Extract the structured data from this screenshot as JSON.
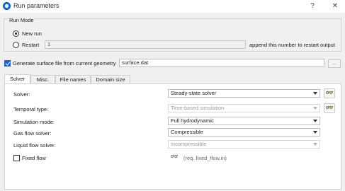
{
  "window": {
    "title": "Run parameters",
    "help_label": "?",
    "close_label": "✕"
  },
  "run_mode": {
    "group_title": "Run Mode",
    "new_run_label": "New run",
    "restart_label": "Restart",
    "restart_value": "1",
    "restart_hint": "append this number to restart output",
    "selected": "New run"
  },
  "surface": {
    "checkbox_label": "Generate surface file from current geometry",
    "checked": true,
    "file_value": "surface.dat",
    "browse_label": "..."
  },
  "tabs": [
    {
      "label": "Solver",
      "active": true
    },
    {
      "label": "Misc.",
      "active": false
    },
    {
      "label": "File names",
      "active": false
    },
    {
      "label": "Domain size",
      "active": false
    }
  ],
  "solver_panel": {
    "solver_label": "Solver:",
    "solver_value": "Steady-state solver",
    "temporal_label": "Temporal type:",
    "temporal_value": "Time-based simulation",
    "simulation_label": "Simulation mode:",
    "simulation_value": "Full hydrodynamic",
    "gas_label": "Gas flow solver:",
    "gas_value": "Compressible",
    "liquid_label": "Liquid flow solver:",
    "liquid_value": "Incompressible",
    "fixed_flow_label": "Fixed flow",
    "fixed_flow_checked": false,
    "fixed_flow_note": "(req. fixed_flow.in)",
    "edit_icon_text": "ơơ"
  }
}
